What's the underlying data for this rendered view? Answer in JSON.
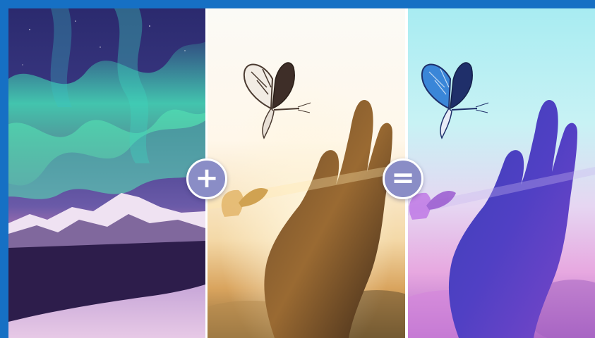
{
  "composition": {
    "description_order": [
      "source-image",
      "style-image",
      "result-image"
    ],
    "operators": {
      "plus": "+",
      "equals": "="
    }
  },
  "panels": {
    "source": {
      "subject": "aurora-over-snowy-mountain"
    },
    "style": {
      "subject": "hand-reaching-to-butterflies-at-sunset"
    },
    "result": {
      "subject": "hand-and-butterflies-in-aurora-palette"
    }
  },
  "colors": {
    "frame_border": "#1670c4",
    "operator_fill": "#8a8dc6",
    "aurora_green": "#3fe0b0",
    "sky_violet": "#4a3a86",
    "sunset_gold": "#e8b760",
    "result_violet": "#4a40c0"
  }
}
